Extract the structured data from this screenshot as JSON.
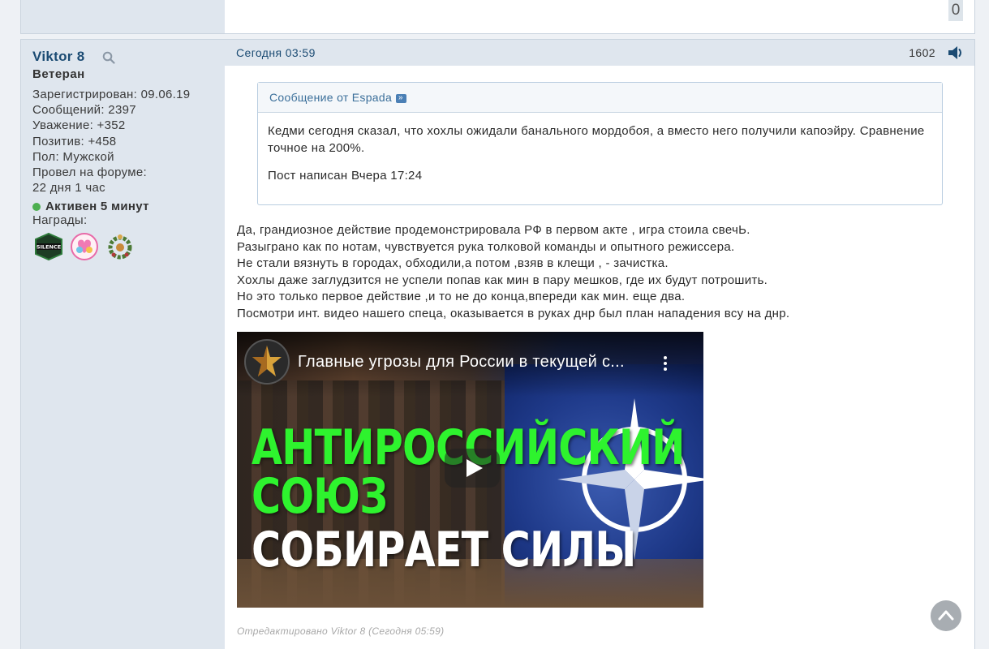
{
  "previous_post": {
    "counter": "0"
  },
  "author": {
    "name": "Viktor 8",
    "rank": "Ветеран",
    "info": [
      "Зарегистрирован: 09.06.19",
      "Сообщений: 2397",
      "Уважение: +352",
      "Позитив: +458",
      "Пол: Мужской",
      "Провел на форуме:",
      "22 дня 1 час"
    ],
    "online_status": "Активен 5 минут",
    "awards_label": "Награды:",
    "awards": [
      "silence-award-icon",
      "hearts-award-icon",
      "wreath-award-icon"
    ]
  },
  "post": {
    "date": "Сегодня 03:59",
    "number": "1602",
    "quote": {
      "header": "Сообщение от Espada",
      "lines": [
        "Кедми сегодня сказал, что хохлы ожидали банального мордобоя, а вместо него получили капоэйру. Сравнение точное на 200%.",
        "Пост написан Вчера 17:24"
      ]
    },
    "message_lines": [
      "Да, грандиозное действие продемонстрировала РФ в первом акте , игра стоила свечЬ.",
      "Разыграно как по нотам, чувствуется рука толковой команды и опытного режиссера.",
      "Не стали вязнуть в городах, обходили,а потом ,взяв в клещи , - зачистка.",
      "Хохлы даже заглудзится не успели попав как мин в пару мешков, где их будут потрошить.",
      "Но это только первое действие ,и то не до конца,впереди как мин. еще два.",
      "Посмотри инт. видео нашего спеца, оказывается в руках днр был план нападения всу на днр."
    ],
    "video": {
      "title": "Главные угрозы для России в текущей с...",
      "thumb_lines": [
        "АНТИРОССИЙСКИЙ",
        "СОЮЗ",
        "СОБИРАЕТ СИЛЫ"
      ]
    },
    "edited_note": "Отредактировано Viktor 8 (Сегодня 05:59)"
  },
  "colors": {
    "username": "#1b4b73",
    "sidebar_bg": "#dfe6ee",
    "online": "#4caf50",
    "thumb_green": "#2ef32e"
  }
}
